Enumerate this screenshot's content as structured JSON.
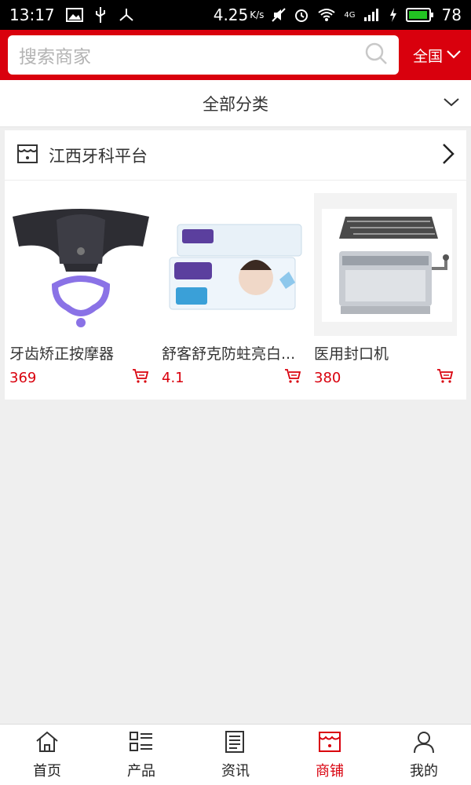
{
  "status_bar": {
    "time": "13:17",
    "speed": "4.25",
    "speed_unit": "K/s",
    "network": "4G",
    "battery": "78"
  },
  "header": {
    "search_placeholder": "搜索商家",
    "region_label": "全国"
  },
  "category_bar": {
    "label": "全部分类"
  },
  "shop": {
    "name": "江西牙科平台",
    "products": [
      {
        "title": "牙齿矫正按摩器",
        "price": "369"
      },
      {
        "title": "舒客舒克防蛀亮白...",
        "price": "4.1"
      },
      {
        "title": "医用封口机",
        "price": "380"
      }
    ]
  },
  "tab_bar": {
    "active_index": 3,
    "tabs": [
      {
        "label": "首页",
        "icon": "home-icon"
      },
      {
        "label": "产品",
        "icon": "list-icon"
      },
      {
        "label": "资讯",
        "icon": "news-icon"
      },
      {
        "label": "商铺",
        "icon": "shop-icon"
      },
      {
        "label": "我的",
        "icon": "user-icon"
      }
    ]
  },
  "colors": {
    "brand_red": "#d9000d",
    "background": "#efefef"
  }
}
